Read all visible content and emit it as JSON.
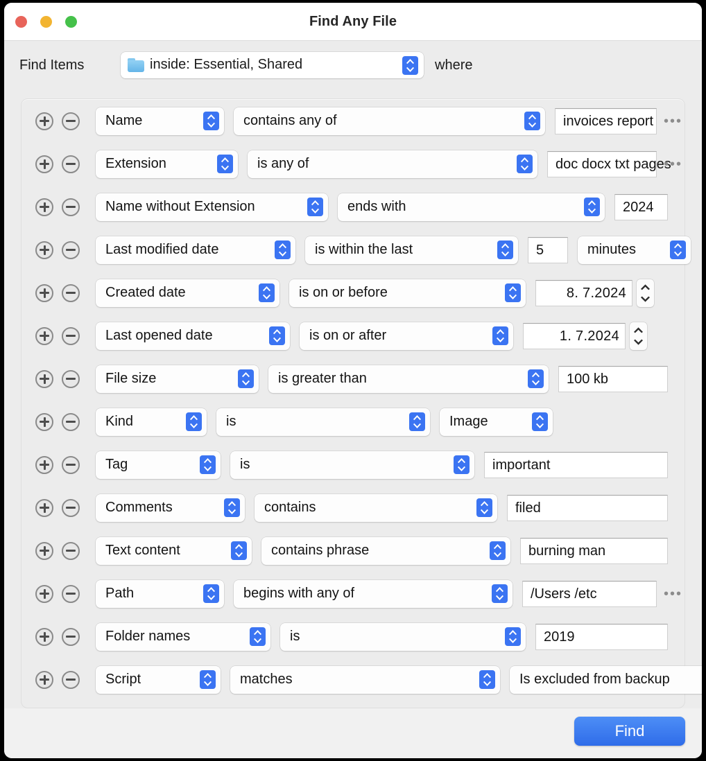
{
  "window": {
    "title": "Find Any File",
    "traffic_lights": [
      {
        "name": "close-button",
        "color": "#e8645a"
      },
      {
        "name": "minimize-button",
        "color": "#f2b431"
      },
      {
        "name": "maximize-button",
        "color": "#45c14a"
      }
    ]
  },
  "header": {
    "find_items_label": "Find Items",
    "scope_icon": "folder-icon",
    "scope_value": "inside: Essential, Shared",
    "where_label": "where"
  },
  "row_controls": {
    "add_label": "+",
    "remove_label": "−",
    "ellipsis_label": "•••"
  },
  "criteria": [
    {
      "attribute": "Name",
      "operator": "contains any of",
      "value": "invoices report",
      "value_kind": "text",
      "has_ellipsis": true
    },
    {
      "attribute": "Extension",
      "operator": "is any of",
      "value": "doc docx txt pages",
      "value_kind": "text",
      "has_ellipsis": true
    },
    {
      "attribute": "Name without Extension",
      "operator": "ends with",
      "value": "2024",
      "value_kind": "text",
      "has_ellipsis": false
    },
    {
      "attribute": "Last modified date",
      "operator": "is within the last",
      "value": "5",
      "value_kind": "number-unit",
      "unit": "minutes",
      "has_ellipsis": false
    },
    {
      "attribute": "Created date",
      "operator": "is on or before",
      "value": "8.  7.2024",
      "value_kind": "date",
      "has_ellipsis": false
    },
    {
      "attribute": "Last opened date",
      "operator": "is on or after",
      "value": "1.  7.2024",
      "value_kind": "date",
      "has_ellipsis": false
    },
    {
      "attribute": "File size",
      "operator": "is greater than",
      "value": "100 kb",
      "value_kind": "text",
      "has_ellipsis": false
    },
    {
      "attribute": "Kind",
      "operator": "is",
      "value": "Image",
      "value_kind": "popup",
      "has_ellipsis": false
    },
    {
      "attribute": "Tag",
      "operator": "is",
      "value": "important",
      "value_kind": "text",
      "has_ellipsis": false
    },
    {
      "attribute": "Comments",
      "operator": "contains",
      "value": "filed",
      "value_kind": "text",
      "has_ellipsis": false
    },
    {
      "attribute": "Text content",
      "operator": "contains phrase",
      "value": "burning man",
      "value_kind": "text",
      "has_ellipsis": false
    },
    {
      "attribute": "Path",
      "operator": "begins with any of",
      "value": "/Users /etc",
      "value_kind": "text",
      "has_ellipsis": true
    },
    {
      "attribute": "Folder names",
      "operator": "is",
      "value": "2019",
      "value_kind": "text",
      "has_ellipsis": false
    },
    {
      "attribute": "Script",
      "operator": "matches",
      "value": "Is excluded from backup",
      "value_kind": "popup",
      "has_ellipsis": false
    }
  ],
  "footer": {
    "find_label": "Find",
    "accent_color": "#3b74f2"
  }
}
